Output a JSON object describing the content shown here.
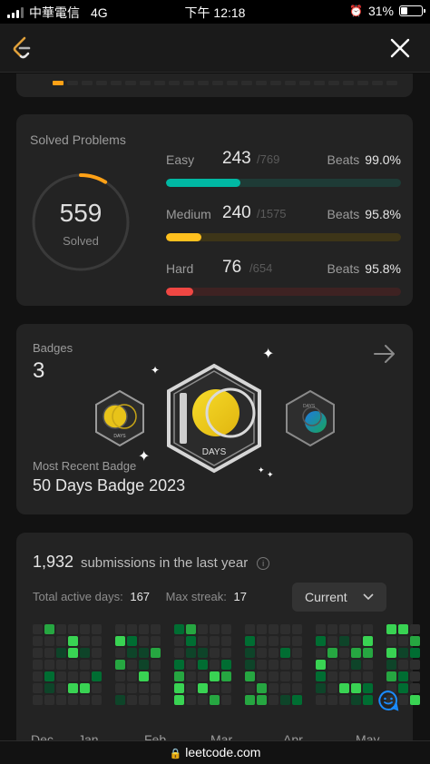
{
  "statusbar": {
    "carrier": "中華電信",
    "network": "4G",
    "time": "下午 12:18",
    "battery": "31%"
  },
  "colors": {
    "accent": "#ffa116",
    "easy": "#00b8a3",
    "medium": "#ffc01e",
    "hard": "#ef4743"
  },
  "solved": {
    "title": "Solved Problems",
    "total": "559",
    "total_label": "Solved",
    "progress": 0.0873,
    "rows": [
      {
        "name": "Easy",
        "solved": "243",
        "total": "/769",
        "beats_label": "Beats",
        "beats": "99.0%",
        "fill": 0.316
      },
      {
        "name": "Medium",
        "solved": "240",
        "total": "/1575",
        "beats_label": "Beats",
        "beats": "95.8%",
        "fill": 0.152
      },
      {
        "name": "Hard",
        "solved": "76",
        "total": "/654",
        "beats_label": "Beats",
        "beats": "95.8%",
        "fill": 0.116
      }
    ]
  },
  "badges": {
    "title": "Badges",
    "count": "3",
    "recent_label": "Most Recent Badge",
    "recent_name": "50 Days Badge 2023",
    "big_badge_text": "DAYS",
    "small_badge_text": "DAYS",
    "right_badge_text": "DAYS"
  },
  "submissions": {
    "count": "1,932",
    "label": "submissions in the last year",
    "active_label": "Total active days:",
    "active_value": "167",
    "streak_label": "Max streak:",
    "streak_value": "17",
    "range": "Current",
    "months": [
      "Dec",
      "Jan",
      "Feb",
      "Mar",
      "Apr",
      "May"
    ]
  },
  "url": "leetcode.com"
}
